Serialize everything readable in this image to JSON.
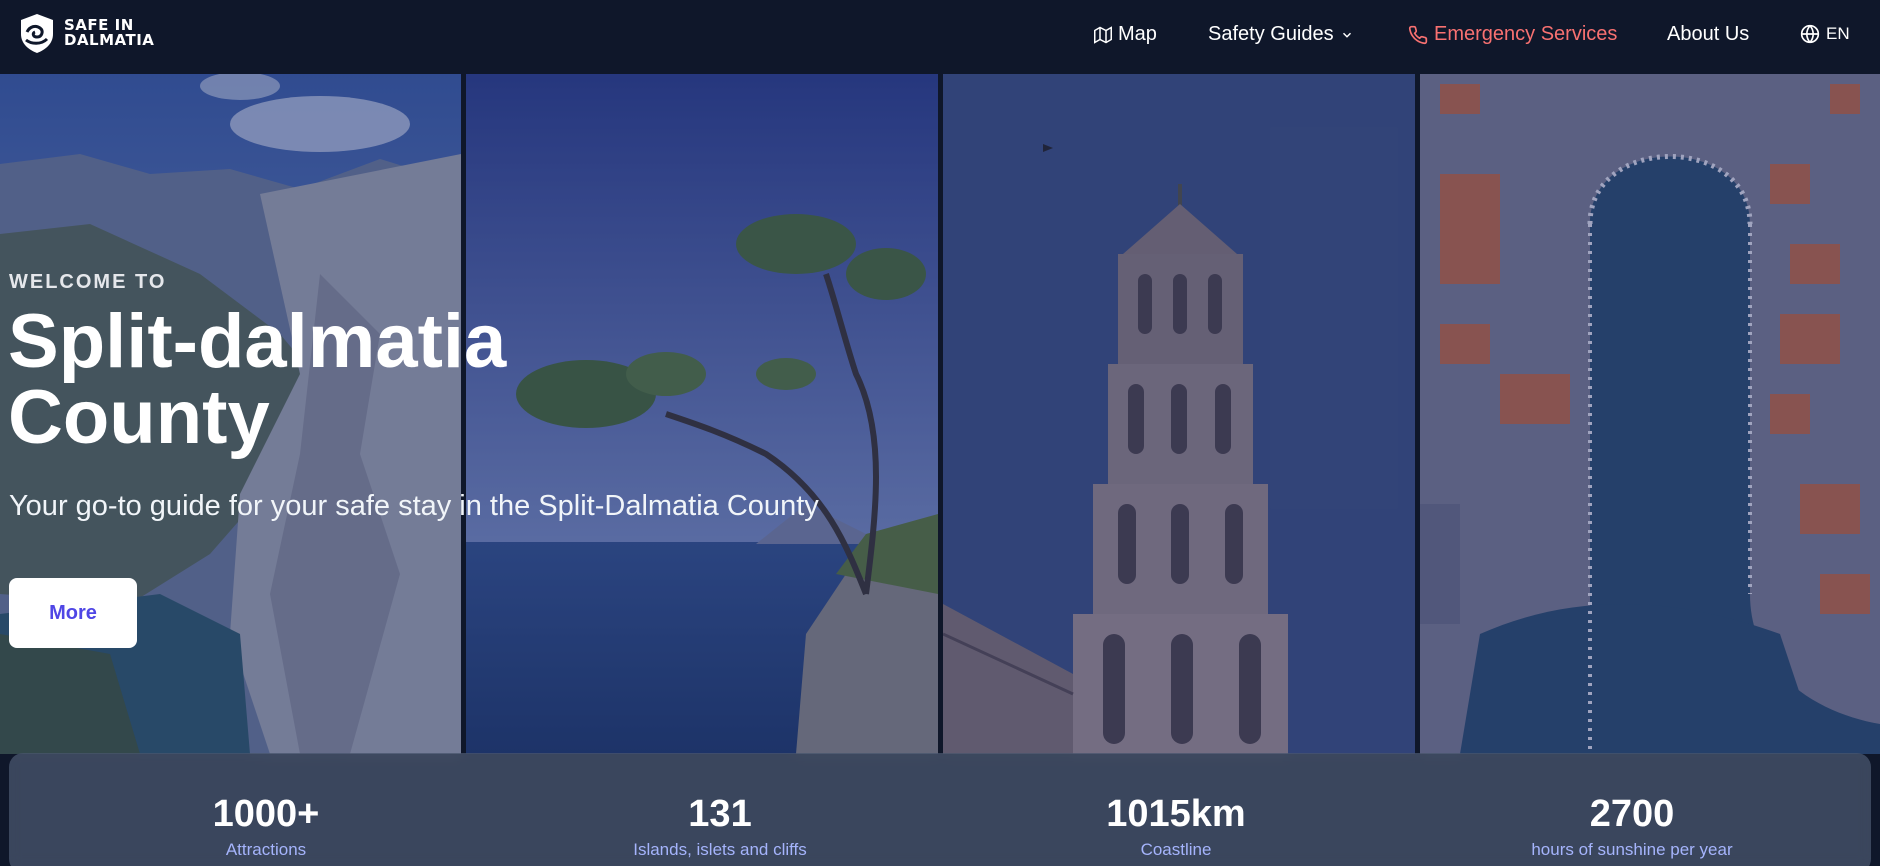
{
  "brand": {
    "line1": "SAFE IN",
    "line2": "DALMATIA"
  },
  "nav": {
    "map": "Map",
    "safety_guides": "Safety Guides",
    "emergency": "Emergency Services",
    "about": "About Us",
    "language": "EN"
  },
  "hero": {
    "welcome": "WELCOME TO",
    "title_line1": "Split-dalmatia",
    "title_line2": "County",
    "subtitle": "Your go-to guide for your safe stay in the Split-Dalmatia County",
    "cta": "More"
  },
  "stats": [
    {
      "value": "1000+",
      "label": "Attractions"
    },
    {
      "value": "131",
      "label": "Islands, islets and cliffs"
    },
    {
      "value": "1015km",
      "label": "Coastline"
    },
    {
      "value": "2700",
      "label": "hours of sunshine per year"
    }
  ],
  "colors": {
    "nav_bg": "#0f172a",
    "emergency": "#f87171",
    "cta_text": "#4f46e5",
    "stat_label": "#a5b4fc"
  }
}
